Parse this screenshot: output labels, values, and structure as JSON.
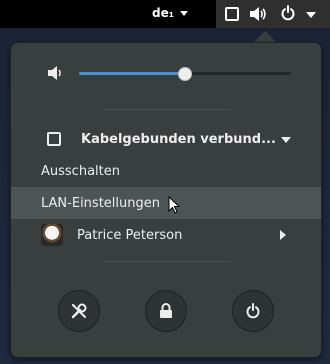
{
  "topbar": {
    "keyboard_layout": "de₁",
    "indicators": [
      "network-icon",
      "volume-icon",
      "power-icon",
      "chevron-down-icon"
    ]
  },
  "volume": {
    "level": 0.5,
    "icon": "volume-low-icon",
    "accent": "#4a90d9"
  },
  "menu": {
    "wired_label": "Kabelgebunden verbund...",
    "shutdown_label": "Ausschalten",
    "lan_settings_label": "LAN-Einstellungen",
    "user_name": "Patrice Peterson"
  },
  "actions": [
    "settings-icon",
    "lock-icon",
    "power-icon"
  ]
}
